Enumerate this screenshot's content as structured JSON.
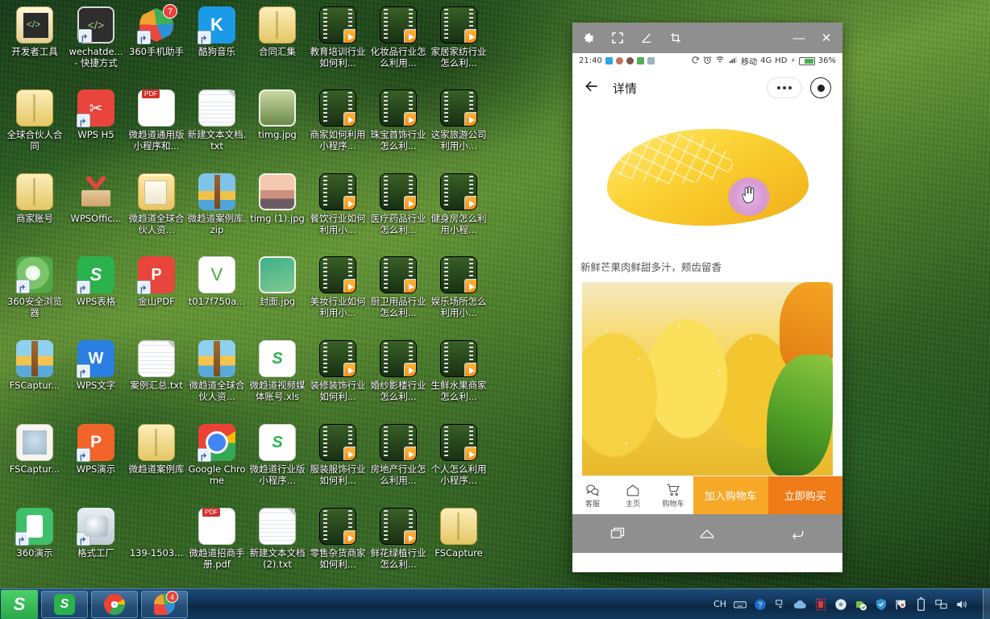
{
  "desktop": {
    "icons": [
      {
        "label": "开发者工具",
        "art": "devtool",
        "shortcut": false
      },
      {
        "label": "wechatde... - 快捷方式",
        "art": "code",
        "shortcut": true
      },
      {
        "label": "360手机助手",
        "art": "360pin",
        "shortcut": true,
        "badge": "7"
      },
      {
        "label": "酷狗音乐",
        "art": "kugou",
        "shortcut": true,
        "glyph": "K"
      },
      {
        "label": "合同汇集",
        "art": "folderplain",
        "shortcut": false
      },
      {
        "label": "教育培训行业如何利...",
        "art": "video",
        "shortcut": false
      },
      {
        "label": "化妆品行业怎么利用...",
        "art": "video",
        "shortcut": false
      },
      {
        "label": "家居家纺行业怎么利...",
        "art": "video",
        "shortcut": false
      },
      {
        "label": "全球合伙人合同",
        "art": "folderplain",
        "shortcut": false
      },
      {
        "label": "WPS H5",
        "art": "wpsh5",
        "shortcut": true,
        "glyph": "✂"
      },
      {
        "label": "微趋道通用版小程序和...",
        "art": "pdf",
        "shortcut": false
      },
      {
        "label": "新建文本文档.txt",
        "art": "txt",
        "shortcut": false
      },
      {
        "label": "timg.jpg",
        "art": "img",
        "shortcut": false
      },
      {
        "label": "商家如何利用小程序...",
        "art": "video",
        "shortcut": false
      },
      {
        "label": "珠宝首饰行业怎么利...",
        "art": "video",
        "shortcut": false
      },
      {
        "label": "这家旅游公司利用小...",
        "art": "video",
        "shortcut": false
      },
      {
        "label": "商家账号",
        "art": "folderplain",
        "shortcut": false
      },
      {
        "label": "WPSOffic...",
        "art": "wpsoffice",
        "shortcut": false
      },
      {
        "label": "微趋道全球合伙人资...",
        "art": "folder",
        "shortcut": false
      },
      {
        "label": "微趋道案例库.zip",
        "art": "zip",
        "shortcut": false
      },
      {
        "label": "timg (1).jpg",
        "art": "img-sunset",
        "shortcut": false
      },
      {
        "label": "餐饮行业如何利用小...",
        "art": "video",
        "shortcut": false
      },
      {
        "label": "医疗药品行业怎么利...",
        "art": "video",
        "shortcut": false
      },
      {
        "label": "健身房怎么利用小程...",
        "art": "video",
        "shortcut": false
      },
      {
        "label": "360安全浏览器",
        "art": "360browser",
        "shortcut": true,
        "glyph": "e"
      },
      {
        "label": "WPS表格",
        "art": "wpss",
        "shortcut": true,
        "glyph": "S"
      },
      {
        "label": "金山PDF",
        "art": "kspdf",
        "shortcut": true,
        "glyph": "P"
      },
      {
        "label": "t017f750a...",
        "art": "weidao",
        "shortcut": false,
        "glyph": "V"
      },
      {
        "label": "封面.jpg",
        "art": "img-cover",
        "shortcut": false
      },
      {
        "label": "美妆行业如何利用小...",
        "art": "video",
        "shortcut": false
      },
      {
        "label": "厨卫用品行业怎么利...",
        "art": "video",
        "shortcut": false
      },
      {
        "label": "娱乐场所怎么利用小...",
        "art": "video",
        "shortcut": false
      },
      {
        "label": "FSCaptur...",
        "art": "fscap",
        "shortcut": false
      },
      {
        "label": "WPS文字",
        "art": "wpsw",
        "shortcut": true,
        "glyph": "W"
      },
      {
        "label": "案例汇总.txt",
        "art": "txt",
        "shortcut": false
      },
      {
        "label": "微趋道全球合伙人资...",
        "art": "fscap",
        "shortcut": false
      },
      {
        "label": "微趋道视频媒体账号.xls",
        "art": "xls",
        "shortcut": false,
        "glyph": "S"
      },
      {
        "label": "装修装饰行业如何利...",
        "art": "video",
        "shortcut": false
      },
      {
        "label": "婚纱影楼行业怎么利...",
        "art": "video",
        "shortcut": false
      },
      {
        "label": "生鲜水果商家怎么利...",
        "art": "video",
        "shortcut": false
      },
      {
        "label": "FSCaptur...",
        "art": "fscapdoc",
        "shortcut": false
      },
      {
        "label": "WPS演示",
        "art": "wpsp",
        "shortcut": true,
        "glyph": "P"
      },
      {
        "label": "微趋道案例库",
        "art": "folderplain",
        "shortcut": false
      },
      {
        "label": "Google Chrome",
        "art": "chrome",
        "shortcut": true
      },
      {
        "label": "微趋道行业版小程序...",
        "art": "xls",
        "shortcut": false,
        "glyph": "S"
      },
      {
        "label": "服装服饰行业如何利...",
        "art": "video",
        "shortcut": false
      },
      {
        "label": "房地产行业怎么利用...",
        "art": "video",
        "shortcut": false
      },
      {
        "label": "个人怎么利用小程序...",
        "art": "video",
        "shortcut": false
      },
      {
        "label": "360演示",
        "art": "360play",
        "shortcut": true
      },
      {
        "label": "格式工厂",
        "art": "fmtfactory",
        "shortcut": true
      },
      {
        "label": "139-1503...",
        "art": "none",
        "shortcut": false
      },
      {
        "label": "微趋道招商手册.pdf",
        "art": "pdf",
        "shortcut": false
      },
      {
        "label": "新建文本文档 (2).txt",
        "art": "txt",
        "shortcut": false
      },
      {
        "label": "零售杂货商家如何利...",
        "art": "video",
        "shortcut": false
      },
      {
        "label": "鲜花绿植行业怎么利...",
        "art": "video",
        "shortcut": false
      },
      {
        "label": "FSCapture",
        "art": "folderplain",
        "shortcut": false
      }
    ]
  },
  "phone_window": {
    "titlebar": {
      "tools": [
        {
          "name": "settings-icon",
          "title": "设置"
        },
        {
          "name": "fullscreen-icon",
          "title": "全屏"
        },
        {
          "name": "draw-icon",
          "title": "画笔"
        },
        {
          "name": "crop-icon",
          "title": "截图"
        }
      ],
      "minimize_label": "—",
      "close_label": "✕"
    },
    "statusbar": {
      "time": "21:40",
      "carrier": "移动",
      "network": "4G",
      "hd": "HD",
      "battery": "36%",
      "charging": "⚡"
    },
    "navbar": {
      "back_icon": "back-arrow-icon",
      "title": "详情",
      "more_icon": "more-dots-icon",
      "target_icon": "target-icon"
    },
    "product": {
      "description": "新鲜芒果肉鲜甜多汁，颊齿留香"
    },
    "action_bar": {
      "items": [
        {
          "label": "客服",
          "icon": "service-chat-icon"
        },
        {
          "label": "主页",
          "icon": "home-icon"
        },
        {
          "label": "购物车",
          "icon": "cart-icon"
        }
      ],
      "add_to_cart": "加入购物车",
      "buy_now": "立即购买"
    },
    "softkeys": [
      {
        "name": "recents-key",
        "glyph": "recents"
      },
      {
        "name": "home-key",
        "glyph": "home"
      },
      {
        "name": "back-key",
        "glyph": "back"
      }
    ]
  },
  "taskbar": {
    "start_label": "S",
    "tasks": [
      {
        "name": "taskbar-wps-spreadsheet",
        "glyph": "S"
      },
      {
        "name": "taskbar-chrome",
        "glyph": "chrome"
      },
      {
        "name": "taskbar-360",
        "glyph": "360",
        "badge": "4"
      }
    ],
    "tray": {
      "ime_label": "CH",
      "icons": [
        {
          "name": "keyboard-icon"
        },
        {
          "name": "help-icon"
        },
        {
          "name": "overflow-icon"
        },
        {
          "name": "cloud-icon"
        },
        {
          "name": "recorder-icon"
        },
        {
          "name": "disc-icon"
        },
        {
          "name": "download-ok-icon"
        },
        {
          "name": "shield-icon"
        },
        {
          "name": "flag-warning-icon"
        },
        {
          "name": "battery-icon"
        },
        {
          "name": "network-icon"
        },
        {
          "name": "volume-icon"
        }
      ]
    }
  }
}
